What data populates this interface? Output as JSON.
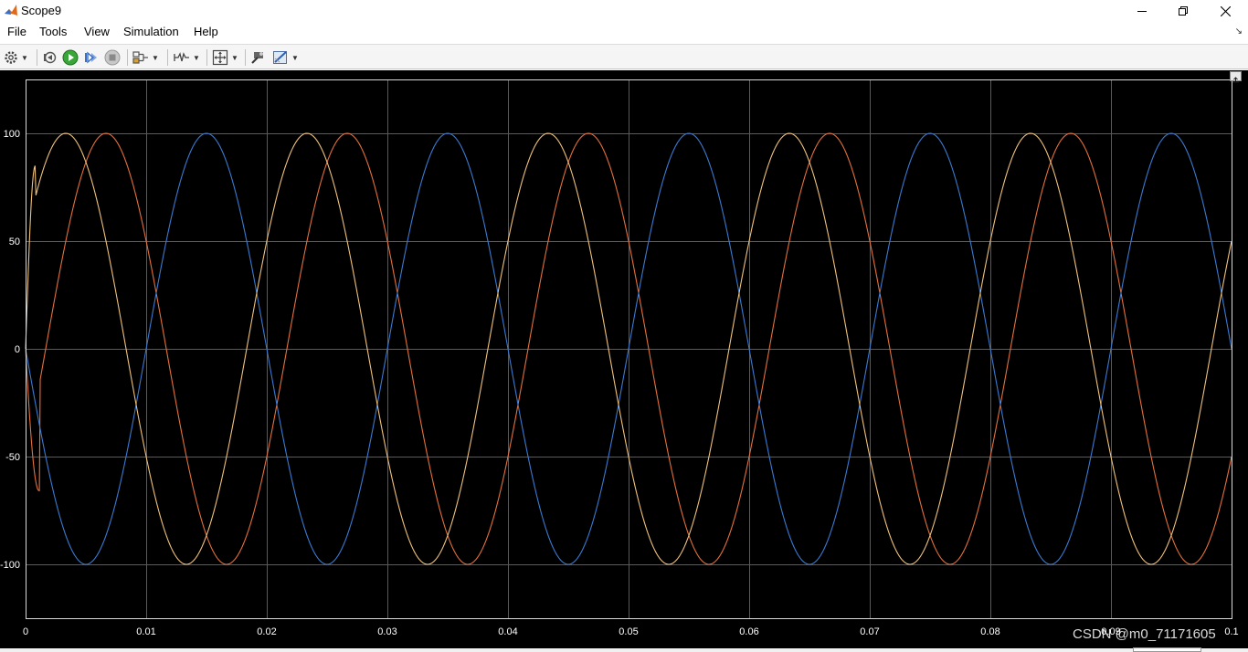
{
  "window": {
    "title": "Scope9",
    "icon": "matlab-logo-icon"
  },
  "menu": [
    "File",
    "Tools",
    "View",
    "Simulation",
    "Help"
  ],
  "toolbar": {
    "items": [
      "settings-icon",
      "step-back-icon",
      "run-icon",
      "step-forward-icon",
      "stop-icon",
      "signal-selector-icon",
      "trigger-icon",
      "zoom-fit-icon",
      "highlight-block-icon",
      "style-icon"
    ]
  },
  "watermark": "CSDN @m0_71171605",
  "colors": {
    "background": "#000000",
    "grid": "#5a5a5a",
    "axis_text": "#ffffff",
    "series": [
      "#e4703b",
      "#3a7ad1",
      "#efc27a"
    ]
  },
  "chart_data": {
    "type": "line",
    "title": "",
    "xlabel": "",
    "ylabel": "",
    "xlim": [
      0,
      0.1
    ],
    "ylim": [
      -125,
      125
    ],
    "grid": true,
    "x_ticks": [
      0,
      0.01,
      0.02,
      0.03,
      0.04,
      0.05,
      0.06,
      0.07,
      0.08,
      0.09,
      0.1
    ],
    "x_tick_labels": [
      "0",
      "0.01",
      "0.02",
      "0.03",
      "0.04",
      "0.05",
      "0.06",
      "0.07",
      "0.08",
      "0.09",
      "0.1"
    ],
    "y_ticks": [
      -100,
      -50,
      0,
      50,
      100
    ],
    "y_tick_labels": [
      "-100",
      "-50",
      "0",
      "50",
      "100"
    ],
    "series": [
      {
        "color": "#e4703b",
        "amplitude": 100,
        "frequency_hz": 50,
        "phase_deg": -30,
        "transient_min": -77
      },
      {
        "color": "#3a7ad1",
        "amplitude": 100,
        "frequency_hz": 50,
        "phase_deg": 180
      },
      {
        "color": "#efc27a",
        "amplitude": 100,
        "frequency_hz": 50,
        "phase_deg": 30,
        "transient_peak": 100
      }
    ]
  }
}
